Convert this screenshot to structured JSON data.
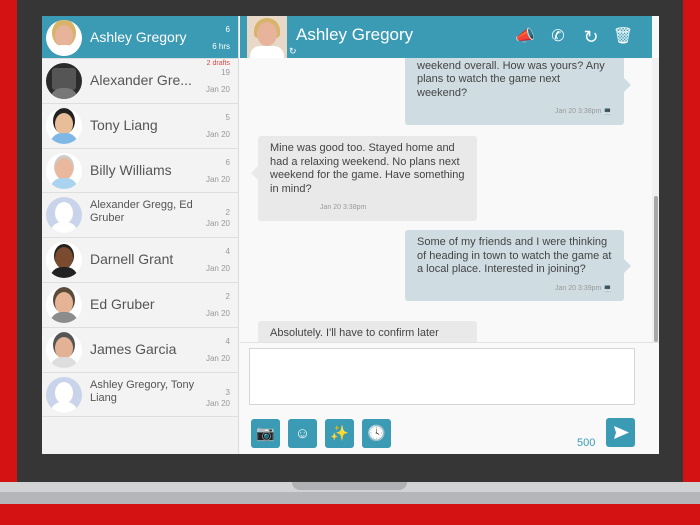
{
  "colors": {
    "accent": "#3b9ab4",
    "frame": "#d41214",
    "bezel": "#363636",
    "drafts": "#e04646"
  },
  "conversations": [
    {
      "name": "Ashley Gregory",
      "count": "6",
      "time": "6 hrs",
      "active": true
    },
    {
      "name": "Alexander Gre...",
      "count": "19",
      "time": "Jan 20",
      "drafts": "2 drafts"
    },
    {
      "name": "Tony Liang",
      "count": "5",
      "time": "Jan 20"
    },
    {
      "name": "Billy Williams",
      "count": "6",
      "time": "Jan 20"
    },
    {
      "name": "Alexander Gregg, Ed Gruber",
      "count": "2",
      "time": "Jan 20"
    },
    {
      "name": "Darnell Grant",
      "count": "4",
      "time": "Jan 20"
    },
    {
      "name": "Ed Gruber",
      "count": "2",
      "time": "Jan 20"
    },
    {
      "name": "James Garcia",
      "count": "4",
      "time": "Jan 20"
    },
    {
      "name": "Ashley Gregory, Tony Liang",
      "count": "3",
      "time": "Jan 20"
    }
  ],
  "chat": {
    "title": "Ashley Gregory",
    "header_icons": [
      "megaphone-icon",
      "phone-icon",
      "sync-icon",
      "trash-icon"
    ],
    "messages": [
      {
        "dir": "out",
        "text": "stores and had a nice lunch. A relaxing weekend overall. How was yours? Any plans to watch the game next weekend?",
        "stamp": "Jan 20 3:38pm"
      },
      {
        "dir": "in",
        "text": "Mine was good too.  Stayed home and had a relaxing weekend.  No plans next weekend for the game.  Have something in mind?",
        "stamp": "Jan 20 3:38pm"
      },
      {
        "dir": "out",
        "text": "Some of my friends and I were thinking of heading in town to watch the game at a local place. Interested in joining?",
        "stamp": "Jan 20 3:39pm"
      },
      {
        "dir": "in",
        "text": "Absolutely.  I'll have to confirm later",
        "stamp": ""
      }
    ],
    "compose": {
      "value": "",
      "char_count": "500"
    },
    "toolbar": [
      "camera-icon",
      "emoji-icon",
      "magic-wand-icon",
      "clock-icon"
    ]
  }
}
